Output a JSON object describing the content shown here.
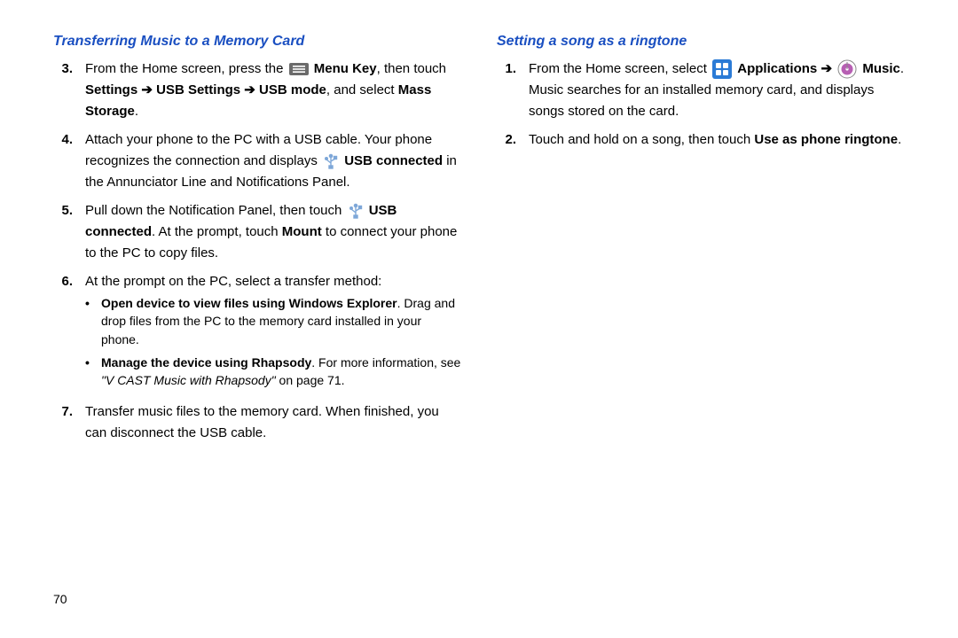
{
  "page_number": "70",
  "left": {
    "heading": "Transferring Music to a Memory Card",
    "items": [
      {
        "num": "3.",
        "runs": [
          {
            "t": "From the Home screen, press the "
          },
          {
            "icon": "menu-key"
          },
          {
            "t": " "
          },
          {
            "t": "Menu Key",
            "b": true
          },
          {
            "t": ", then touch "
          },
          {
            "t": "Settings",
            "b": true
          },
          {
            "t": " ",
            "b": true
          },
          {
            "t": "➔",
            "b": true,
            "arrow": true
          },
          {
            "t": " ",
            "b": true
          },
          {
            "t": "USB Settings",
            "b": true
          },
          {
            "t": " ",
            "b": true
          },
          {
            "t": "➔",
            "b": true,
            "arrow": true
          },
          {
            "t": " ",
            "b": true
          },
          {
            "t": "USB mode",
            "b": true
          },
          {
            "t": ", and select "
          },
          {
            "t": "Mass Storage",
            "b": true
          },
          {
            "t": "."
          }
        ]
      },
      {
        "num": "4.",
        "runs": [
          {
            "t": "Attach your phone to the PC with a USB cable. Your phone recognizes the connection and displays "
          },
          {
            "icon": "usb"
          },
          {
            "t": " "
          },
          {
            "t": "USB connected",
            "b": true
          },
          {
            "t": " in the Annunciator Line and Notifications Panel."
          }
        ]
      },
      {
        "num": "5.",
        "runs": [
          {
            "t": "Pull down the Notification Panel, then touch "
          },
          {
            "icon": "usb"
          },
          {
            "t": " "
          },
          {
            "t": "USB connected",
            "b": true
          },
          {
            "t": ". At the prompt, touch "
          },
          {
            "t": "Mount",
            "b": true
          },
          {
            "t": " to connect your phone to the PC to copy files."
          }
        ]
      },
      {
        "num": "6.",
        "runs": [
          {
            "t": "At the prompt on the PC, select a transfer method:"
          }
        ],
        "bullets": [
          {
            "runs": [
              {
                "t": "Open device to view files using Windows Explorer",
                "b": true
              },
              {
                "t": ". Drag and drop files from the PC to the memory card installed in your phone."
              }
            ]
          },
          {
            "runs": [
              {
                "t": "Manage the device using Rhapsody",
                "b": true
              },
              {
                "t": ". For more information, see "
              },
              {
                "t": "\"V CAST Music with Rhapsody\"",
                "i": true
              },
              {
                "t": " on page 71."
              }
            ]
          }
        ]
      },
      {
        "num": "7.",
        "runs": [
          {
            "t": "Transfer music files to the memory card. When finished, you can disconnect the USB cable."
          }
        ]
      }
    ]
  },
  "right": {
    "heading": "Setting a song as a ringtone",
    "items": [
      {
        "num": "1.",
        "runs": [
          {
            "t": "From the Home screen, select "
          },
          {
            "icon": "apps"
          },
          {
            "t": " "
          },
          {
            "t": "Applications",
            "b": true
          },
          {
            "t": " "
          },
          {
            "t": "➔",
            "b": true,
            "arrow": true
          },
          {
            "t": " "
          },
          {
            "icon": "music"
          },
          {
            "t": " "
          },
          {
            "t": "Music",
            "b": true
          },
          {
            "t": ". Music searches for an installed memory card, and displays songs stored on the card."
          }
        ]
      },
      {
        "num": "2.",
        "runs": [
          {
            "t": "Touch and hold on a song, then touch "
          },
          {
            "t": "Use as phone ringtone",
            "b": true
          },
          {
            "t": "."
          }
        ]
      }
    ]
  },
  "icons": {
    "menu-key": "menu-key-icon",
    "usb": "usb-icon",
    "apps": "applications-icon",
    "music": "music-icon"
  }
}
